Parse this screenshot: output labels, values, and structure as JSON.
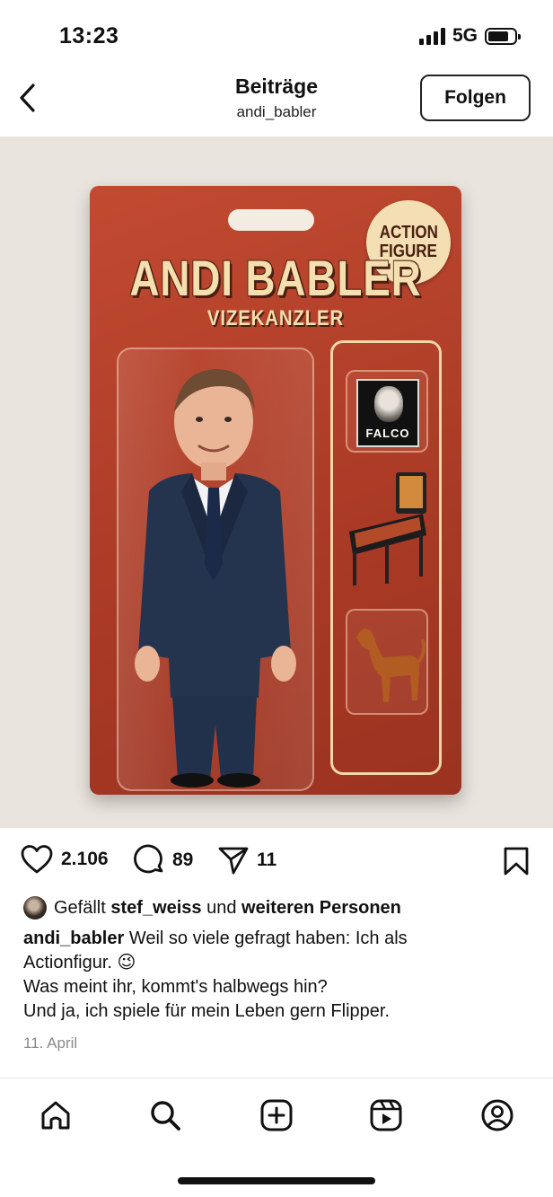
{
  "status_bar": {
    "time": "13:23",
    "network": "5G",
    "icons": [
      "signal-icon",
      "battery-icon"
    ]
  },
  "header": {
    "title": "Beiträge",
    "subtitle": "andi_babler",
    "follow_label": "Folgen",
    "back_icon": "chevron-left-icon"
  },
  "post_image": {
    "figure_name": "ANDI BABLER",
    "figure_role": "VIZEKANZLER",
    "badge_line1": "ACTION",
    "badge_line2": "FIGURE",
    "record_label": "FALCO",
    "colors": {
      "card": "#b2412a",
      "background": "#e9e4dd",
      "title_text": "#f6dfae",
      "suit": "#24344f"
    }
  },
  "engagement": {
    "likes": "2.106",
    "comments": "89",
    "shares": "11",
    "icons": [
      "heart-icon",
      "comment-icon",
      "share-icon",
      "bookmark-icon"
    ]
  },
  "likes_line": {
    "prefix": "Gefällt",
    "user": "stef_weiss",
    "middle": "und",
    "rest": "weiteren Personen"
  },
  "caption": {
    "author": "andi_babler",
    "line1": "Weil so viele gefragt haben: Ich als",
    "line2": "Actionfigur. 😉",
    "line3": "Was meint ihr, kommt's halbwegs hin?",
    "line4": "Und ja, ich spiele für mein Leben gern Flipper."
  },
  "date": "11. April",
  "bottom_nav": [
    "home-icon",
    "search-icon",
    "create-icon",
    "reels-icon",
    "profile-icon"
  ]
}
